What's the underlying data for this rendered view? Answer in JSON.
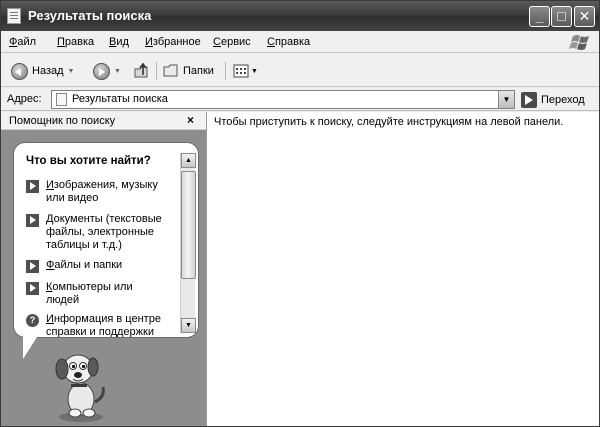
{
  "window": {
    "title": "Результаты поиска"
  },
  "caption_buttons": {
    "minimize": "_",
    "maximize": "□",
    "close": "✕"
  },
  "menu": [
    {
      "label": "Файл",
      "accel": "Ф",
      "rest": "айл"
    },
    {
      "label": "Правка",
      "accel": "П",
      "rest": "равка"
    },
    {
      "label": "Вид",
      "accel": "В",
      "rest": "ид"
    },
    {
      "label": "Избранное",
      "accel": "И",
      "rest": "збранное"
    },
    {
      "label": "Сервис",
      "accel": "С",
      "rest": "ервис"
    },
    {
      "label": "Справка",
      "accel": "С",
      "rest": "правка"
    }
  ],
  "toolbar": {
    "back_label": "Назад",
    "folders_label": "Папки"
  },
  "address": {
    "label": "Адрес:",
    "value": "Результаты поиска",
    "go_label": "Переход"
  },
  "left_pane": {
    "title": "Помощник по поиску",
    "close": "×",
    "question": "Что вы хотите найти?",
    "options": [
      {
        "line1_pre": "",
        "line1_u": "И",
        "line1_rest": "зображения, музыку",
        "line2": "или видео",
        "icon": "arrow-right-icon"
      },
      {
        "line1_pre": "",
        "line1_u": "Д",
        "line1_rest": "окументы (текстовые",
        "line2": "файлы, электронные",
        "line3": "таблицы и т.д.)",
        "icon": "arrow-right-icon"
      },
      {
        "line1_pre": "",
        "line1_u": "Ф",
        "line1_rest": "айлы и папки",
        "icon": "arrow-right-icon"
      },
      {
        "line1_pre": "",
        "line1_u": "К",
        "line1_rest": "омпьютеры или",
        "line2": "людей",
        "icon": "arrow-right-icon"
      },
      {
        "line1_pre": "",
        "line1_u": "И",
        "line1_rest": "нформация в центре",
        "line2": "справки и поддержки",
        "icon": "help-icon"
      }
    ]
  },
  "right_pane": {
    "message": "Чтобы приступить к поиску, следуйте инструкциям на левой панели."
  }
}
